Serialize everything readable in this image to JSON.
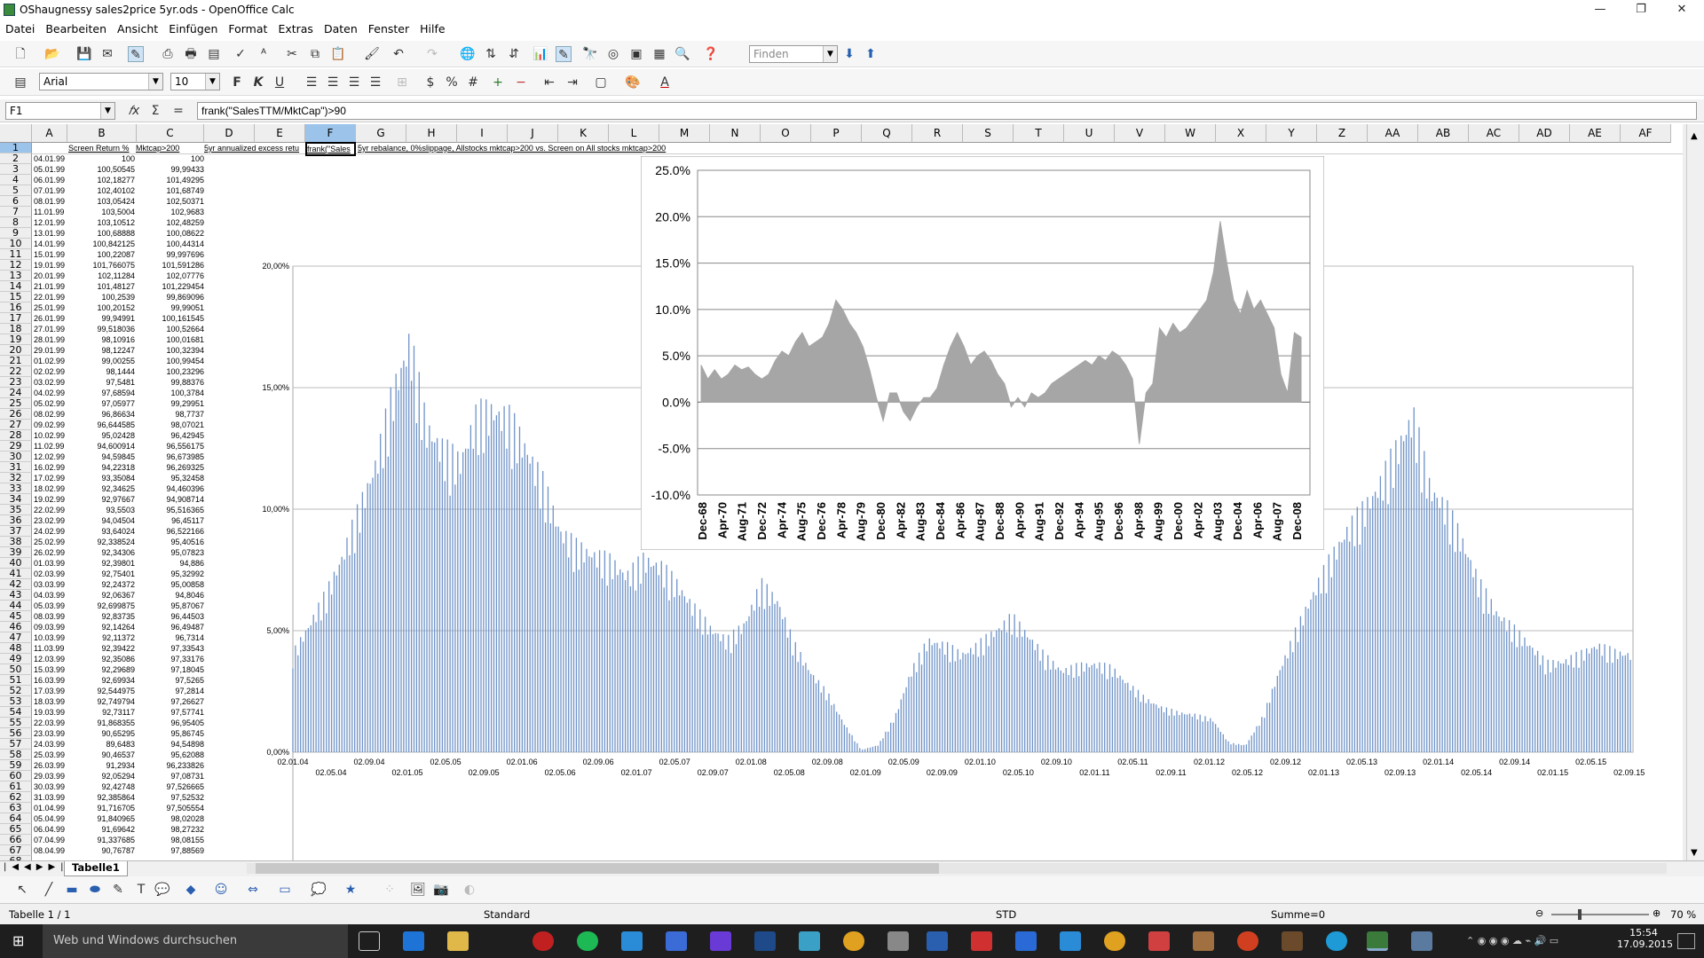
{
  "window": {
    "title": "OShaugnessy sales2price 5yr.ods - OpenOffice Calc",
    "minimize": "—",
    "restore": "❐",
    "close": "✕"
  },
  "menu": [
    "Datei",
    "Bearbeiten",
    "Ansicht",
    "Einfügen",
    "Format",
    "Extras",
    "Daten",
    "Fenster",
    "Hilfe"
  ],
  "toolbar": {
    "find_placeholder": "Finden",
    "font_name": "Arial",
    "font_size": "10",
    "bold": "F",
    "italic": "K",
    "underline": "U"
  },
  "formula": {
    "cell_ref": "F1",
    "content": "frank(\"SalesTTM/MktCap\")>90"
  },
  "columns": [
    "A",
    "B",
    "C",
    "D",
    "E",
    "F",
    "G",
    "H",
    "I",
    "J",
    "K",
    "L",
    "M",
    "N",
    "O",
    "P",
    "Q",
    "R",
    "S",
    "T",
    "U",
    "V",
    "W",
    "X",
    "Y",
    "Z",
    "AA",
    "AB",
    "AC",
    "AD",
    "AE",
    "AF"
  ],
  "header_row": {
    "b": "Screen Return %",
    "c": "Mktcap>200",
    "e": "5yr annualized excess retu",
    "f": "frank(\"Sales",
    "g": "5yr rebalance, 0%slippage, Allstocks mktcap>200 vs. Screen on All stocks mktcap>200"
  },
  "rows": [
    [
      "04.01.99",
      "100",
      "100"
    ],
    [
      "05.01.99",
      "100,50545",
      "99,99433"
    ],
    [
      "06.01.99",
      "102,18277",
      "101,49295"
    ],
    [
      "07.01.99",
      "102,40102",
      "101,68749"
    ],
    [
      "08.01.99",
      "103,05424",
      "102,50371"
    ],
    [
      "11.01.99",
      "103,5004",
      "102,9683"
    ],
    [
      "12.01.99",
      "103,10512",
      "102,48259"
    ],
    [
      "13.01.99",
      "100,68888",
      "100,08622"
    ],
    [
      "14.01.99",
      "100,842125",
      "100,44314"
    ],
    [
      "15.01.99",
      "100,22087",
      "99,997696"
    ],
    [
      "19.01.99",
      "101,766075",
      "101,591286"
    ],
    [
      "20.01.99",
      "102,11284",
      "102,07776"
    ],
    [
      "21.01.99",
      "101,48127",
      "101,229454"
    ],
    [
      "22.01.99",
      "100,2539",
      "99,869096"
    ],
    [
      "25.01.99",
      "100,20152",
      "99,99051"
    ],
    [
      "26.01.99",
      "99,94991",
      "100,161545"
    ],
    [
      "27.01.99",
      "99,518036",
      "100,52664"
    ],
    [
      "28.01.99",
      "98,10916",
      "100,01681"
    ],
    [
      "29.01.99",
      "98,12247",
      "100,32394"
    ],
    [
      "01.02.99",
      "99,00255",
      "100,99454"
    ],
    [
      "02.02.99",
      "98,1444",
      "100,23296"
    ],
    [
      "03.02.99",
      "97,5481",
      "99,88376"
    ],
    [
      "04.02.99",
      "97,68594",
      "100,3784"
    ],
    [
      "05.02.99",
      "97,05977",
      "99,29951"
    ],
    [
      "08.02.99",
      "96,86634",
      "98,7737"
    ],
    [
      "09.02.99",
      "96,644585",
      "98,07021"
    ],
    [
      "10.02.99",
      "95,02428",
      "96,42945"
    ],
    [
      "11.02.99",
      "94,600914",
      "96,556175"
    ],
    [
      "12.02.99",
      "94,59845",
      "96,673985"
    ],
    [
      "16.02.99",
      "94,22318",
      "96,269325"
    ],
    [
      "17.02.99",
      "93,35084",
      "95,32458"
    ],
    [
      "18.02.99",
      "92,34625",
      "94,460396"
    ],
    [
      "19.02.99",
      "92,97667",
      "94,908714"
    ],
    [
      "22.02.99",
      "93,5503",
      "95,516365"
    ],
    [
      "23.02.99",
      "94,04504",
      "96,45117"
    ],
    [
      "24.02.99",
      "93,64024",
      "96,522166"
    ],
    [
      "25.02.99",
      "92,338524",
      "95,40516"
    ],
    [
      "26.02.99",
      "92,34306",
      "95,07823"
    ],
    [
      "01.03.99",
      "92,39801",
      "94,886"
    ],
    [
      "02.03.99",
      "92,75401",
      "95,32992"
    ],
    [
      "03.03.99",
      "92,24372",
      "95,00858"
    ],
    [
      "04.03.99",
      "92,06367",
      "94,8046"
    ],
    [
      "05.03.99",
      "92,699875",
      "95,87067"
    ],
    [
      "08.03.99",
      "92,83735",
      "96,44503"
    ],
    [
      "09.03.99",
      "92,14264",
      "96,49487"
    ],
    [
      "10.03.99",
      "92,11372",
      "96,7314"
    ],
    [
      "11.03.99",
      "92,39422",
      "97,33543"
    ],
    [
      "12.03.99",
      "92,35086",
      "97,33176"
    ],
    [
      "15.03.99",
      "92,29689",
      "97,18045"
    ],
    [
      "16.03.99",
      "92,69934",
      "97,5265"
    ],
    [
      "17.03.99",
      "92,544975",
      "97,2814"
    ],
    [
      "18.03.99",
      "92,749794",
      "97,26627"
    ],
    [
      "19.03.99",
      "92,73117",
      "97,57741"
    ],
    [
      "22.03.99",
      "91,868355",
      "96,95405"
    ],
    [
      "23.03.99",
      "90,65295",
      "95,86745"
    ],
    [
      "24.03.99",
      "89,6483",
      "94,54898"
    ],
    [
      "25.03.99",
      "90,46537",
      "95,62088"
    ],
    [
      "26.03.99",
      "91,2934",
      "96,233826"
    ],
    [
      "29.03.99",
      "92,05294",
      "97,08731"
    ],
    [
      "30.03.99",
      "92,42748",
      "97,526665"
    ],
    [
      "31.03.99",
      "92,385864",
      "97,52532"
    ],
    [
      "01.04.99",
      "91,716705",
      "97,505554"
    ],
    [
      "05.04.99",
      "91,840965",
      "98,02028"
    ],
    [
      "06.04.99",
      "91,69642",
      "98,27232"
    ],
    [
      "07.04.99",
      "91,337685",
      "98,08155"
    ],
    [
      "08.04.99",
      "90,76787",
      "97,88569"
    ]
  ],
  "chart_data": [
    {
      "type": "area",
      "title": "",
      "ylim": [
        0,
        20
      ],
      "yticks": [
        "0,00%",
        "5,00%",
        "10,00%",
        "15,00%",
        "20,00%"
      ],
      "xticks_top": [
        "02.01.04",
        "02.09.04",
        "02.05.05",
        "02.01.06",
        "02.09.06",
        "02.05.07",
        "02.01.08",
        "02.09.08",
        "02.05.09",
        "02.01.10",
        "02.09.10",
        "02.05.11",
        "02.01.12",
        "02.09.12",
        "02.05.13",
        "02.01.14",
        "02.09.14",
        "02.05.15"
      ],
      "xticks_bottom": [
        "02.05.04",
        "02.01.05",
        "02.09.05",
        "02.05.06",
        "02.01.07",
        "02.09.07",
        "02.05.08",
        "02.01.09",
        "02.09.09",
        "02.05.10",
        "02.01.11",
        "02.09.11",
        "02.05.12",
        "02.01.13",
        "02.09.13",
        "02.05.14",
        "02.01.15",
        "02.09.15"
      ],
      "x_range": [
        "02.01.04",
        "02.09.15"
      ],
      "values": [
        4.2,
        5.5,
        6.8,
        8.5,
        10.5,
        12.5,
        15.5,
        17.7,
        14,
        13,
        12.5,
        14.5,
        14.7,
        14.3,
        13,
        11.5,
        9.5,
        8.8,
        8.5,
        8.2,
        7.6,
        8.3,
        8.0,
        7.2,
        6.2,
        5.3,
        4.8,
        5.5,
        7.2,
        6.5,
        4.6,
        3.4,
        2.5,
        1.2,
        0.1,
        0.3,
        1.5,
        3.5,
        4.8,
        4.6,
        4.2,
        4.6,
        5.2,
        5.8,
        5.0,
        4.1,
        3.5,
        3.7,
        3.8,
        3.6,
        2.9,
        2.3,
        1.9,
        1.7,
        1.6,
        1.4,
        0.4,
        0.3,
        1.5,
        3.5,
        5.2,
        6.8,
        8.2,
        9.5,
        10.4,
        11.5,
        13.0,
        14.5,
        11.4,
        10.5,
        9.0,
        7.2,
        6.0,
        5.3,
        4.6,
        3.8,
        3.9,
        4.2,
        4.6,
        4.3,
        4.2
      ]
    },
    {
      "type": "area",
      "title": "",
      "ylim": [
        -10,
        25
      ],
      "yticks": [
        "-10.0%",
        "-5.0%",
        "0.0%",
        "5.0%",
        "10.0%",
        "15.0%",
        "20.0%",
        "25.0%"
      ],
      "xticks": [
        "Dec-68",
        "Apr-70",
        "Aug-71",
        "Dec-72",
        "Apr-74",
        "Aug-75",
        "Dec-76",
        "Apr-78",
        "Aug-79",
        "Dec-80",
        "Apr-82",
        "Aug-83",
        "Dec-84",
        "Apr-86",
        "Aug-87",
        "Dec-88",
        "Apr-90",
        "Aug-91",
        "Dec-92",
        "Apr-94",
        "Aug-95",
        "Dec-96",
        "Apr-98",
        "Aug-99",
        "Dec-00",
        "Apr-02",
        "Aug-03",
        "Dec-04",
        "Apr-06",
        "Aug-07",
        "Dec-08"
      ],
      "values": [
        4,
        2.5,
        3.5,
        2.5,
        3,
        4,
        3.5,
        3.8,
        3,
        2.5,
        3,
        4.5,
        5.5,
        5,
        6.5,
        7.5,
        6,
        6.5,
        7,
        8.5,
        11,
        10,
        8.5,
        7.5,
        6,
        3.5,
        0.5,
        -2,
        1,
        1,
        -1,
        -2,
        -0.5,
        0.5,
        0.5,
        1.5,
        4,
        6,
        7.5,
        6,
        4,
        5,
        5.5,
        4.5,
        3,
        2,
        -0.5,
        0.5,
        -0.5,
        1,
        0.5,
        1,
        2,
        2.5,
        3,
        3.5,
        4,
        4.5,
        4,
        5,
        4.5,
        5.5,
        5,
        4,
        2.5,
        -4.5,
        1,
        2,
        8,
        7,
        8.5,
        7.5,
        8,
        9,
        10,
        11,
        14,
        19.5,
        15,
        11,
        9.5,
        12,
        10,
        11,
        9.5,
        8,
        3,
        1,
        7.5,
        7
      ]
    }
  ],
  "sheet": {
    "tab": "Tabelle1"
  },
  "status": {
    "sheet": "Tabelle 1 / 1",
    "style": "Standard",
    "mode": "STD",
    "sum": "Summe=0",
    "zoom": "70 %"
  },
  "taskbar": {
    "search": "Web und Windows durchsuchen",
    "time": "15:54",
    "date": "17.09.2015"
  }
}
